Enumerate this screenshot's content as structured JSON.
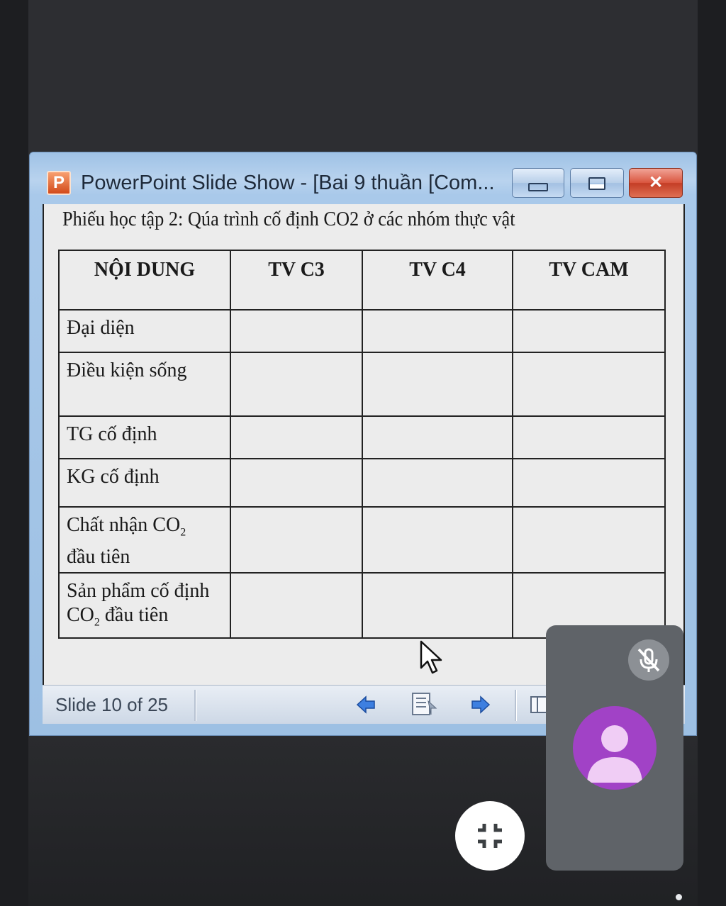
{
  "window": {
    "app_icon_letter": "P",
    "title": "PowerPoint Slide Show - [Bai 9 thuần [Com...",
    "buttons": {
      "minimize": "minimize",
      "maximize": "maximize",
      "close": "✕"
    }
  },
  "slide": {
    "title": "Phiếu học tập 2: Qúa trình cố định CO2 ở các nhóm thực vật",
    "table": {
      "headers": [
        "NỘI DUNG",
        "TV C3",
        "TV C4",
        "TV CAM"
      ],
      "rows": [
        {
          "label": "Đại diện"
        },
        {
          "label": "Điều kiện sống"
        },
        {
          "label": "TG cố định"
        },
        {
          "label": "KG cố định"
        },
        {
          "label_part1": "Chất nhận CO",
          "sub": "2",
          "label_part2": "đầu tiên"
        },
        {
          "label_part1": "Sản phẩm cố định",
          "label_part2a": "CO",
          "sub": "2",
          "label_part2b": " đầu tiên"
        }
      ]
    }
  },
  "statusbar": {
    "slide_counter": "Slide 10 of 25",
    "icons": [
      "previous-slide-icon",
      "slide-menu-icon",
      "next-slide-icon",
      "view-icon"
    ]
  },
  "meeting": {
    "participant_mic": "muted",
    "participant_avatar": "person-icon",
    "colors": {
      "tile": "#5f6368",
      "avatar": "#a142c6",
      "stage": "#2d2e32"
    }
  }
}
